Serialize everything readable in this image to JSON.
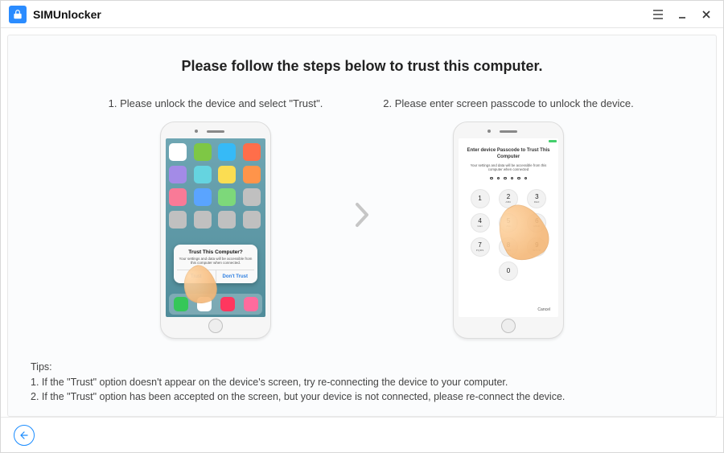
{
  "app": {
    "title": "SIMUnlocker"
  },
  "main": {
    "heading": "Please follow the steps below to trust this computer.",
    "step1": {
      "label": "1. Please unlock the device and select \"Trust\".",
      "dialog": {
        "title": "Trust This Computer?",
        "body": "Your settings and data will be accessible from this computer when connected.",
        "trust": "Trust",
        "dont_trust": "Don't Trust"
      }
    },
    "step2": {
      "label": "2. Please enter screen passcode to unlock the device.",
      "passcode": {
        "title": "Enter device Passcode to Trust This Computer",
        "sub": "Your settings and data will be accessible from this computer when connected",
        "cancel": "Cancel"
      }
    }
  },
  "tips": {
    "header": "Tips:",
    "line1": "1. If the \"Trust\" option doesn't appear on the device's screen, try re-connecting the device to your computer.",
    "line2": "2. If the \"Trust\" option has been accepted on the screen, but your device is not connected, please re-connect the device."
  },
  "keypad": {
    "keys": [
      {
        "num": "1",
        "sub": ""
      },
      {
        "num": "2",
        "sub": "ABC"
      },
      {
        "num": "3",
        "sub": "DEF"
      },
      {
        "num": "4",
        "sub": "GHI"
      },
      {
        "num": "5",
        "sub": "JKL"
      },
      {
        "num": "6",
        "sub": "MNO"
      },
      {
        "num": "7",
        "sub": "PQRS"
      },
      {
        "num": "8",
        "sub": "TUV"
      },
      {
        "num": "9",
        "sub": "WXYZ"
      },
      {
        "num": "0",
        "sub": ""
      }
    ]
  },
  "home_tiles_colors": [
    "#ffffff",
    "#7ec745",
    "#36baf7",
    "#ff6e4a",
    "#a38be7",
    "#65d4e0",
    "#fbdd52",
    "#ff944a",
    "#f97a97",
    "#5aa4ff",
    "#7dd87a",
    "#c0c0c0",
    "#c0c0c0",
    "#c0c0c0",
    "#c0c0c0",
    "#c0c0c0"
  ],
  "dock_colors": [
    "#35c759",
    "#ffffff",
    "#ff375f",
    "#ff6b9d"
  ],
  "colors": {
    "accent": "#1a8cff"
  }
}
